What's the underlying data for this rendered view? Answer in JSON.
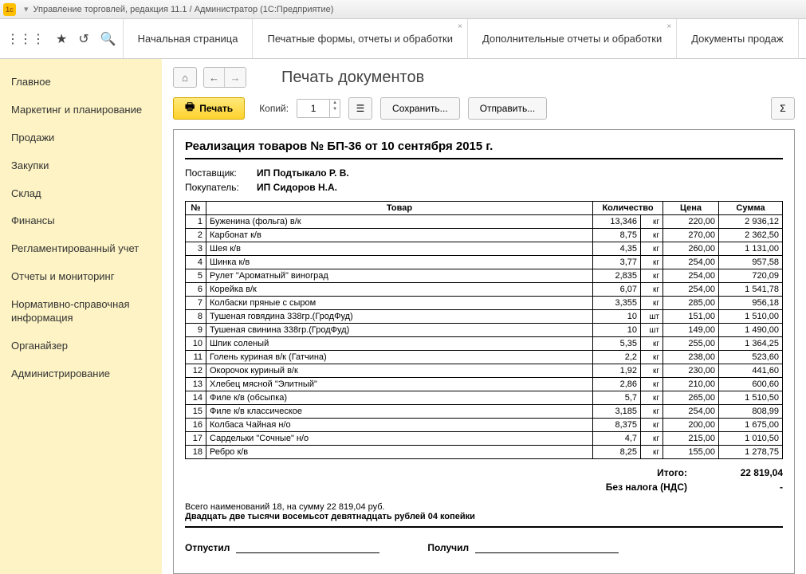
{
  "title": "Управление торговлей, редакция 11.1 / Администратор   (1С:Предприятие)",
  "tabs": [
    "Начальная страница",
    "Печатные формы, отчеты и обработки",
    "Дополнительные отчеты и обработки",
    "Документы продаж"
  ],
  "sidebar": [
    "Главное",
    "Маркетинг и планирование",
    "Продажи",
    "Закупки",
    "Склад",
    "Финансы",
    "Регламентированный учет",
    "Отчеты и мониторинг",
    "Нормативно-справочная информация",
    "Органайзер",
    "Администрирование"
  ],
  "page_title": "Печать документов",
  "toolbar": {
    "print": "Печать",
    "copies_label": "Копий:",
    "copies": "1",
    "save": "Сохранить...",
    "send": "Отправить..."
  },
  "doc": {
    "heading": "Реализация товаров № БП-36 от 10 сентября 2015 г.",
    "supplier_label": "Поставщик:",
    "supplier": "ИП Подтыкало Р. В.",
    "buyer_label": "Покупатель:",
    "buyer": "ИП Сидоров Н.А.",
    "columns": {
      "n": "№",
      "name": "Товар",
      "qty": "Количество",
      "price": "Цена",
      "sum": "Сумма"
    },
    "rows": [
      {
        "n": 1,
        "name": "Буженина (фольга) в/к",
        "qty": "13,346",
        "unit": "кг",
        "price": "220,00",
        "sum": "2 936,12"
      },
      {
        "n": 2,
        "name": "Карбонат к/в",
        "qty": "8,75",
        "unit": "кг",
        "price": "270,00",
        "sum": "2 362,50"
      },
      {
        "n": 3,
        "name": "Шея к/в",
        "qty": "4,35",
        "unit": "кг",
        "price": "260,00",
        "sum": "1 131,00"
      },
      {
        "n": 4,
        "name": "Шинка к/в",
        "qty": "3,77",
        "unit": "кг",
        "price": "254,00",
        "sum": "957,58"
      },
      {
        "n": 5,
        "name": "Рулет \"Ароматный\" виноград",
        "qty": "2,835",
        "unit": "кг",
        "price": "254,00",
        "sum": "720,09"
      },
      {
        "n": 6,
        "name": "Корейка в/к",
        "qty": "6,07",
        "unit": "кг",
        "price": "254,00",
        "sum": "1 541,78"
      },
      {
        "n": 7,
        "name": "Колбаски пряные с сыром",
        "qty": "3,355",
        "unit": "кг",
        "price": "285,00",
        "sum": "956,18"
      },
      {
        "n": 8,
        "name": "Тушеная говядина 338гр.(ГродФуд)",
        "qty": "10",
        "unit": "шт",
        "price": "151,00",
        "sum": "1 510,00"
      },
      {
        "n": 9,
        "name": "Тушеная свинина 338гр.(ГродФуд)",
        "qty": "10",
        "unit": "шт",
        "price": "149,00",
        "sum": "1 490,00"
      },
      {
        "n": 10,
        "name": "Шпик соленый",
        "qty": "5,35",
        "unit": "кг",
        "price": "255,00",
        "sum": "1 364,25"
      },
      {
        "n": 11,
        "name": "Голень куриная в/к (Гатчина)",
        "qty": "2,2",
        "unit": "кг",
        "price": "238,00",
        "sum": "523,60"
      },
      {
        "n": 12,
        "name": "Окорочок куриный в/к",
        "qty": "1,92",
        "unit": "кг",
        "price": "230,00",
        "sum": "441,60"
      },
      {
        "n": 13,
        "name": "Хлебец мясной \"Элитный\"",
        "qty": "2,86",
        "unit": "кг",
        "price": "210,00",
        "sum": "600,60"
      },
      {
        "n": 14,
        "name": "Филе к/в (обсыпка)",
        "qty": "5,7",
        "unit": "кг",
        "price": "265,00",
        "sum": "1 510,50"
      },
      {
        "n": 15,
        "name": "Филе к/в классическое",
        "qty": "3,185",
        "unit": "кг",
        "price": "254,00",
        "sum": "808,99"
      },
      {
        "n": 16,
        "name": "Колбаса Чайная н/о",
        "qty": "8,375",
        "unit": "кг",
        "price": "200,00",
        "sum": "1 675,00"
      },
      {
        "n": 17,
        "name": "Сардельки \"Сочные\" н/о",
        "qty": "4,7",
        "unit": "кг",
        "price": "215,00",
        "sum": "1 010,50"
      },
      {
        "n": 18,
        "name": "Ребро к/в",
        "qty": "8,25",
        "unit": "кг",
        "price": "155,00",
        "sum": "1 278,75"
      }
    ],
    "totals": {
      "label": "Итого:",
      "value": "22 819,04",
      "tax_label": "Без налога (НДС)",
      "tax_value": "-"
    },
    "summary_line": "Всего наименований 18, на сумму 22 819,04 руб.",
    "summary_words": "Двадцать две тысячи восемьсот девятнадцать рублей 04 копейки",
    "sign": {
      "released": "Отпустил",
      "received": "Получил"
    }
  }
}
